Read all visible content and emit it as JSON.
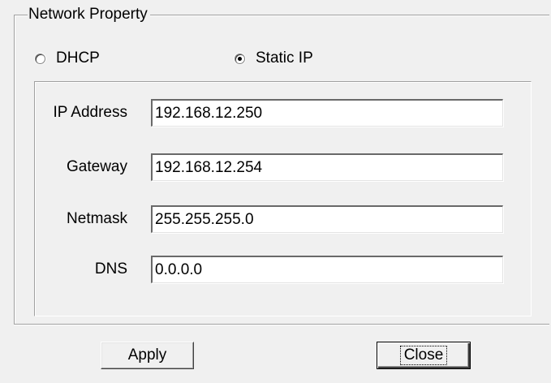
{
  "group": {
    "title": "Network Property"
  },
  "mode": {
    "options": [
      {
        "label": "DHCP",
        "selected": false
      },
      {
        "label": "Static IP",
        "selected": true
      }
    ]
  },
  "fields": {
    "ip_address": {
      "label": "IP Address",
      "value": "192.168.12.250"
    },
    "gateway": {
      "label": "Gateway",
      "value": "192.168.12.254"
    },
    "netmask": {
      "label": "Netmask",
      "value": "255.255.255.0"
    },
    "dns": {
      "label": "DNS",
      "value": "0.0.0.0"
    }
  },
  "buttons": {
    "apply_label": "Apply",
    "close_label": "Close"
  },
  "colors": {
    "window_bg": "#f0f0f0",
    "input_bg": "#ffffff",
    "border_shadow": "#a0a0a0"
  }
}
